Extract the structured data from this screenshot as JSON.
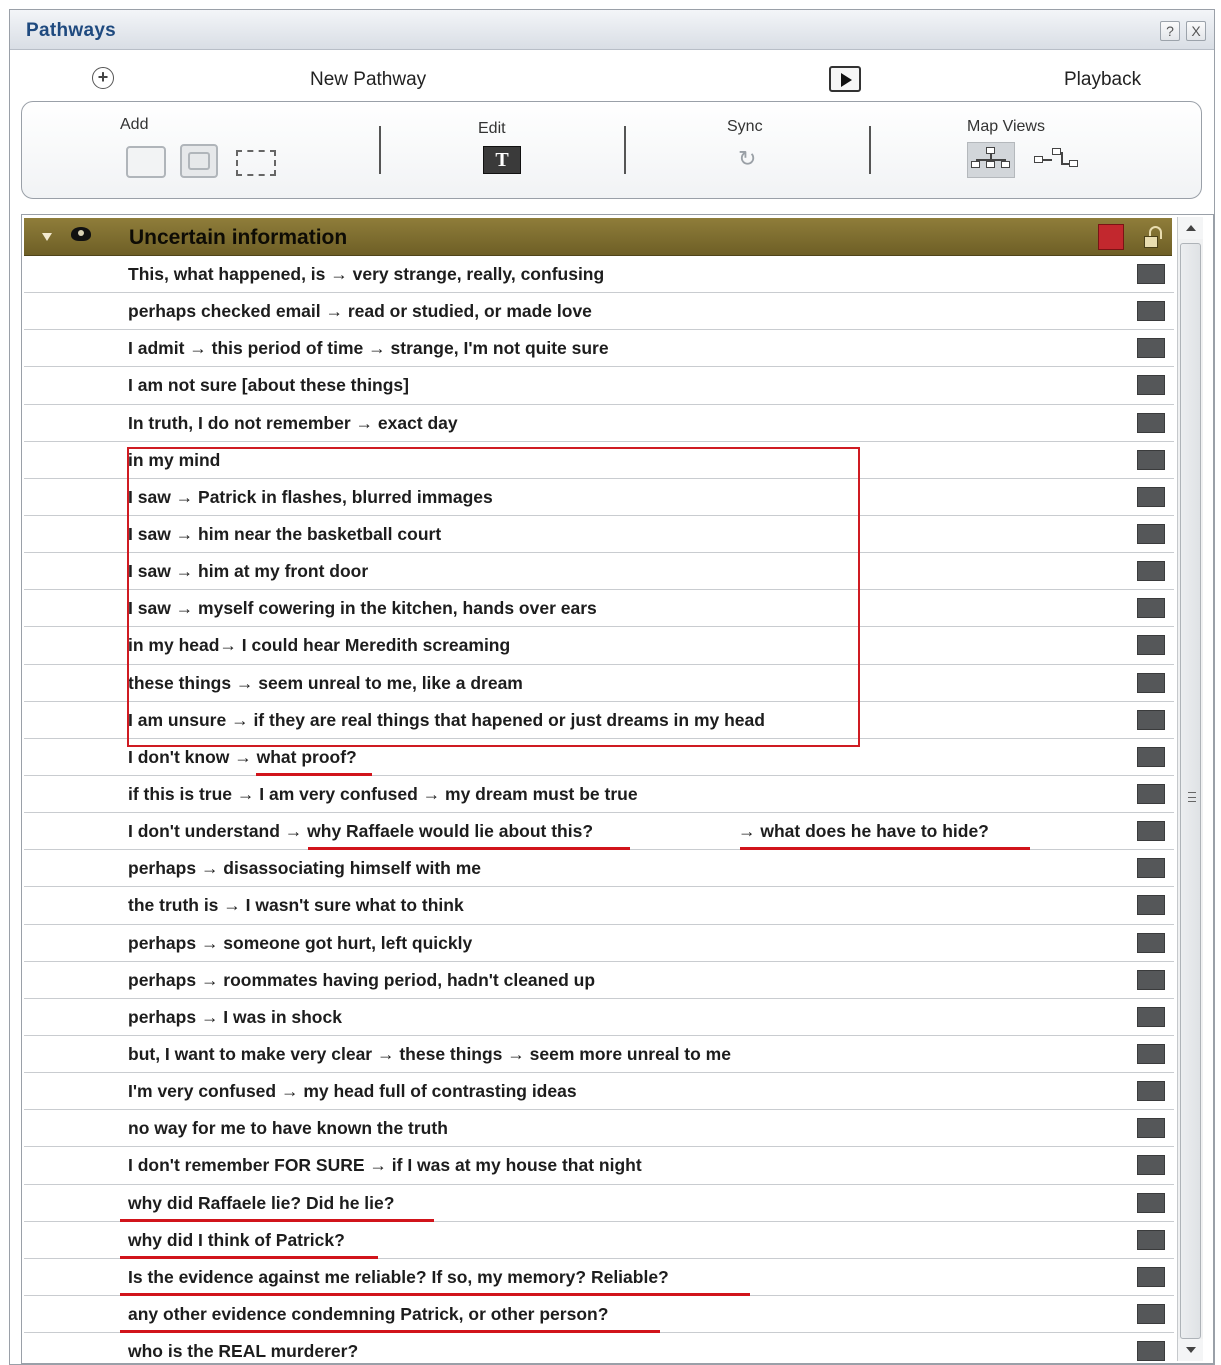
{
  "window": {
    "title": "Pathways",
    "help_label": "?",
    "close_label": "X"
  },
  "toolbar": {
    "new_pathway_label": "New Pathway",
    "playback_label": "Playback",
    "new_icon": "circle-plus-icon",
    "play_icon": "play-icon"
  },
  "tools": {
    "add_label": "Add",
    "edit_label": "Edit",
    "edit_icon_text": "T",
    "sync_label": "Sync",
    "sync_icon": "↻",
    "map_views_label": "Map Views"
  },
  "group": {
    "title": "Uncertain information",
    "color": "#c2282e"
  },
  "rows": [
    {
      "text": "This, what happened, is  →  very strange, really, confusing"
    },
    {
      "text": "perhaps checked email →  read or studied, or made love"
    },
    {
      "text": "I admit →  this period of time →  strange, I'm not quite sure"
    },
    {
      "text": "I am not sure [about these things]"
    },
    {
      "text": "In truth, I do not remember →  exact day"
    },
    {
      "text": "in my mind"
    },
    {
      "text": "I saw →  Patrick in flashes, blurred immages"
    },
    {
      "text": "I saw →  him near the basketball court"
    },
    {
      "text": "I saw →  him at my front door"
    },
    {
      "text": "I saw →  myself cowering in the kitchen, hands over ears"
    },
    {
      "text": "in my head→  I could hear Meredith screaming"
    },
    {
      "text": "these things →  seem unreal to me, like a dream"
    },
    {
      "text": "I am unsure →  if they are real things that hapened or just dreams in my head"
    },
    {
      "text": "I don't know →  what proof?"
    },
    {
      "text": "if this is true →  I am very confused →  my dream must be true"
    },
    {
      "text": "I don't understand →  why Raffaele would lie about this?",
      "text2": "→  what does he have to hide?"
    },
    {
      "text": "perhaps →  disassociating himself with me"
    },
    {
      "text": "the truth is  →  I wasn't sure what to think"
    },
    {
      "text": "perhaps →  someone got hurt, left quickly"
    },
    {
      "text": "perhaps →  roommates having period, hadn't cleaned up"
    },
    {
      "text": "perhaps →  I was in shock"
    },
    {
      "text": "but, I want to make very clear  →  these things →  seem more unreal to me"
    },
    {
      "text": "I'm very confused →  my head full of contrasting ideas"
    },
    {
      "text": "no way for me to have known the truth"
    },
    {
      "text": "I don't remember FOR SURE →  if I was at my house that night"
    },
    {
      "text": "why did Raffaele lie? Did he lie?"
    },
    {
      "text": "why did I think of Patrick?"
    },
    {
      "text": "Is the evidence against me reliable?  If so, my memory? Reliable?"
    },
    {
      "text": "any other evidence condemning Patrick, or other person?"
    },
    {
      "text": "who is the REAL murderer?"
    }
  ],
  "colors": {
    "accent_title": "#1f4a7f",
    "group_header": "#8f7d3a",
    "annotation_red": "#d1141b",
    "row_swatch": "#555759"
  }
}
